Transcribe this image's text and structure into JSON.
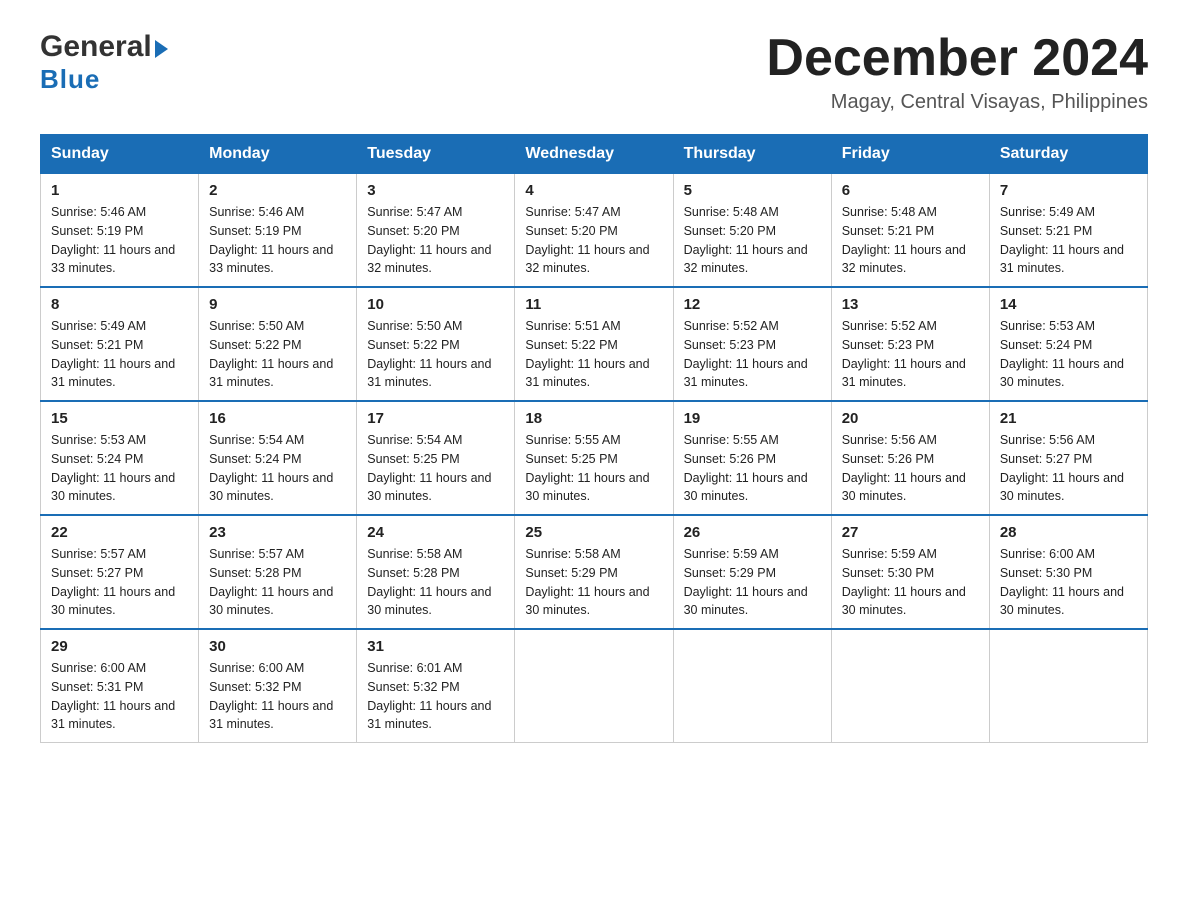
{
  "header": {
    "logo_general": "General",
    "logo_blue": "Blue",
    "month_title": "December 2024",
    "location": "Magay, Central Visayas, Philippines"
  },
  "days_of_week": [
    "Sunday",
    "Monday",
    "Tuesday",
    "Wednesday",
    "Thursday",
    "Friday",
    "Saturday"
  ],
  "weeks": [
    [
      {
        "day": "1",
        "sunrise": "5:46 AM",
        "sunset": "5:19 PM",
        "daylight": "11 hours and 33 minutes."
      },
      {
        "day": "2",
        "sunrise": "5:46 AM",
        "sunset": "5:19 PM",
        "daylight": "11 hours and 33 minutes."
      },
      {
        "day": "3",
        "sunrise": "5:47 AM",
        "sunset": "5:20 PM",
        "daylight": "11 hours and 32 minutes."
      },
      {
        "day": "4",
        "sunrise": "5:47 AM",
        "sunset": "5:20 PM",
        "daylight": "11 hours and 32 minutes."
      },
      {
        "day": "5",
        "sunrise": "5:48 AM",
        "sunset": "5:20 PM",
        "daylight": "11 hours and 32 minutes."
      },
      {
        "day": "6",
        "sunrise": "5:48 AM",
        "sunset": "5:21 PM",
        "daylight": "11 hours and 32 minutes."
      },
      {
        "day": "7",
        "sunrise": "5:49 AM",
        "sunset": "5:21 PM",
        "daylight": "11 hours and 31 minutes."
      }
    ],
    [
      {
        "day": "8",
        "sunrise": "5:49 AM",
        "sunset": "5:21 PM",
        "daylight": "11 hours and 31 minutes."
      },
      {
        "day": "9",
        "sunrise": "5:50 AM",
        "sunset": "5:22 PM",
        "daylight": "11 hours and 31 minutes."
      },
      {
        "day": "10",
        "sunrise": "5:50 AM",
        "sunset": "5:22 PM",
        "daylight": "11 hours and 31 minutes."
      },
      {
        "day": "11",
        "sunrise": "5:51 AM",
        "sunset": "5:22 PM",
        "daylight": "11 hours and 31 minutes."
      },
      {
        "day": "12",
        "sunrise": "5:52 AM",
        "sunset": "5:23 PM",
        "daylight": "11 hours and 31 minutes."
      },
      {
        "day": "13",
        "sunrise": "5:52 AM",
        "sunset": "5:23 PM",
        "daylight": "11 hours and 31 minutes."
      },
      {
        "day": "14",
        "sunrise": "5:53 AM",
        "sunset": "5:24 PM",
        "daylight": "11 hours and 30 minutes."
      }
    ],
    [
      {
        "day": "15",
        "sunrise": "5:53 AM",
        "sunset": "5:24 PM",
        "daylight": "11 hours and 30 minutes."
      },
      {
        "day": "16",
        "sunrise": "5:54 AM",
        "sunset": "5:24 PM",
        "daylight": "11 hours and 30 minutes."
      },
      {
        "day": "17",
        "sunrise": "5:54 AM",
        "sunset": "5:25 PM",
        "daylight": "11 hours and 30 minutes."
      },
      {
        "day": "18",
        "sunrise": "5:55 AM",
        "sunset": "5:25 PM",
        "daylight": "11 hours and 30 minutes."
      },
      {
        "day": "19",
        "sunrise": "5:55 AM",
        "sunset": "5:26 PM",
        "daylight": "11 hours and 30 minutes."
      },
      {
        "day": "20",
        "sunrise": "5:56 AM",
        "sunset": "5:26 PM",
        "daylight": "11 hours and 30 minutes."
      },
      {
        "day": "21",
        "sunrise": "5:56 AM",
        "sunset": "5:27 PM",
        "daylight": "11 hours and 30 minutes."
      }
    ],
    [
      {
        "day": "22",
        "sunrise": "5:57 AM",
        "sunset": "5:27 PM",
        "daylight": "11 hours and 30 minutes."
      },
      {
        "day": "23",
        "sunrise": "5:57 AM",
        "sunset": "5:28 PM",
        "daylight": "11 hours and 30 minutes."
      },
      {
        "day": "24",
        "sunrise": "5:58 AM",
        "sunset": "5:28 PM",
        "daylight": "11 hours and 30 minutes."
      },
      {
        "day": "25",
        "sunrise": "5:58 AM",
        "sunset": "5:29 PM",
        "daylight": "11 hours and 30 minutes."
      },
      {
        "day": "26",
        "sunrise": "5:59 AM",
        "sunset": "5:29 PM",
        "daylight": "11 hours and 30 minutes."
      },
      {
        "day": "27",
        "sunrise": "5:59 AM",
        "sunset": "5:30 PM",
        "daylight": "11 hours and 30 minutes."
      },
      {
        "day": "28",
        "sunrise": "6:00 AM",
        "sunset": "5:30 PM",
        "daylight": "11 hours and 30 minutes."
      }
    ],
    [
      {
        "day": "29",
        "sunrise": "6:00 AM",
        "sunset": "5:31 PM",
        "daylight": "11 hours and 31 minutes."
      },
      {
        "day": "30",
        "sunrise": "6:00 AM",
        "sunset": "5:32 PM",
        "daylight": "11 hours and 31 minutes."
      },
      {
        "day": "31",
        "sunrise": "6:01 AM",
        "sunset": "5:32 PM",
        "daylight": "11 hours and 31 minutes."
      },
      null,
      null,
      null,
      null
    ]
  ],
  "labels": {
    "sunrise": "Sunrise:",
    "sunset": "Sunset:",
    "daylight": "Daylight:"
  }
}
